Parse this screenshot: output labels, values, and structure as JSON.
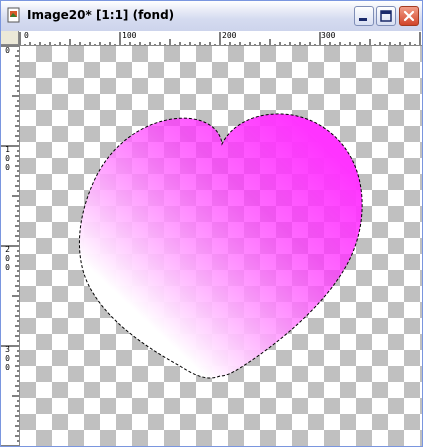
{
  "window": {
    "title": "Image20* [1:1] (fond)"
  },
  "colors": {
    "gradient_start": "#ff33ff",
    "gradient_end": "#ffffff",
    "checker_dark": "#c0c0c0",
    "checker_light": "#ffffff"
  },
  "rulers": {
    "horizontal": [
      "0",
      "100",
      "200",
      "300"
    ],
    "vertical": [
      [
        "0"
      ],
      [
        "1",
        "0",
        "0"
      ],
      [
        "2",
        "0",
        "0"
      ],
      [
        "3",
        "0",
        "0"
      ]
    ]
  }
}
